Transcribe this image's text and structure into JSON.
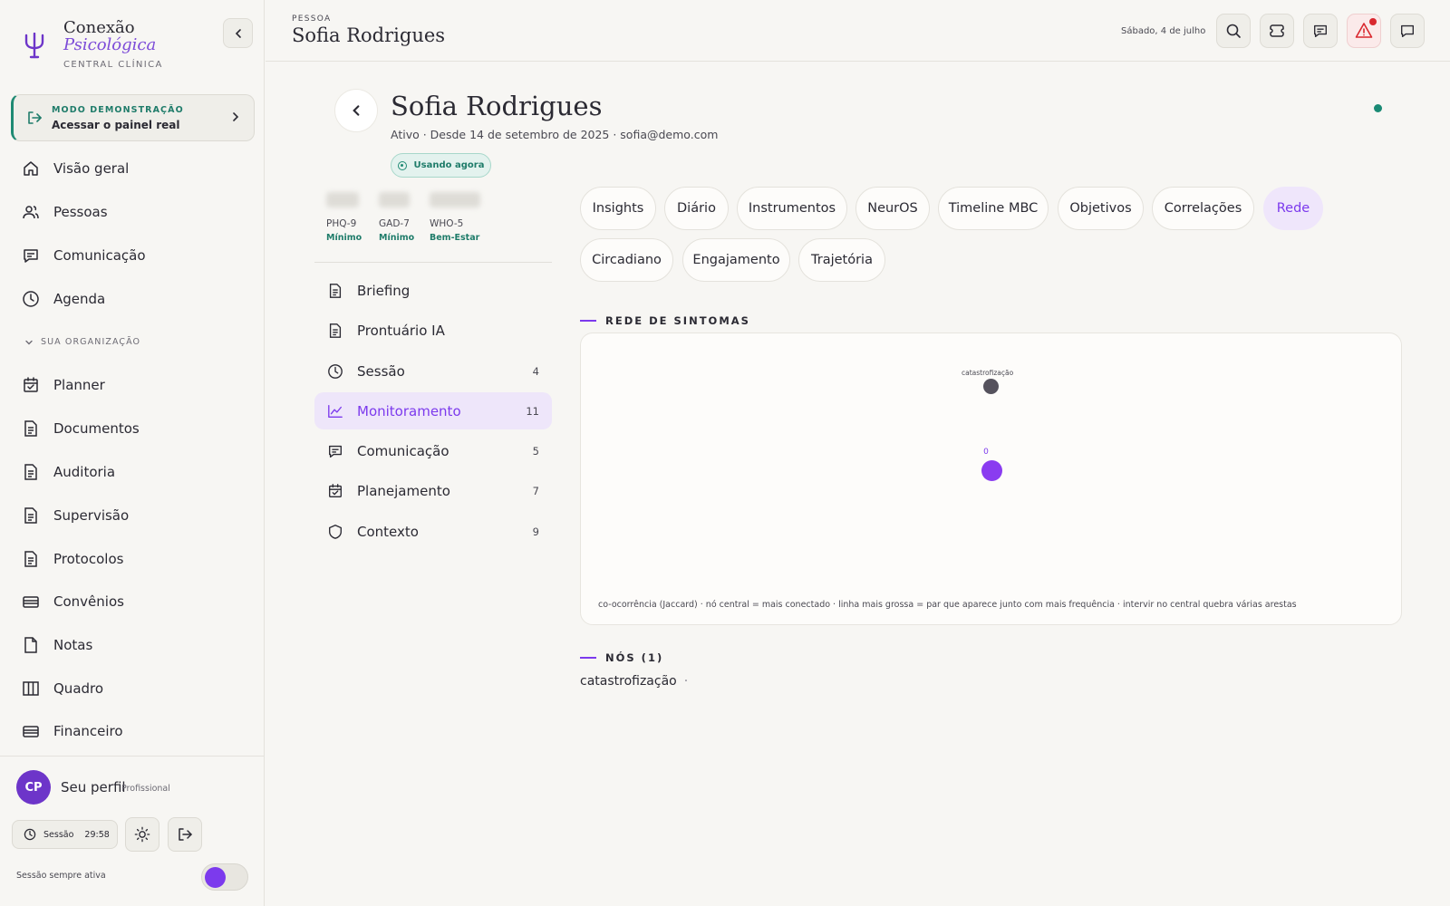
{
  "app": {
    "brand_line1": "Conexão",
    "brand_line2": "Psicológica",
    "brand_line3": "CENTRAL CLÍNICA"
  },
  "demo": {
    "tag": "MODO DEMONSTRAÇÃO",
    "text": "Acessar o painel real"
  },
  "sidebar": {
    "main_items": [
      {
        "label": "Visão geral",
        "icon": "home-icon"
      },
      {
        "label": "Pessoas",
        "icon": "users-icon"
      },
      {
        "label": "Comunicação",
        "icon": "message-icon"
      },
      {
        "label": "Agenda",
        "icon": "clock-icon"
      }
    ],
    "org_label": "SUA ORGANIZAÇÃO",
    "org_items": [
      {
        "label": "Planner",
        "icon": "calendar-check-icon"
      },
      {
        "label": "Documentos",
        "icon": "document-icon"
      },
      {
        "label": "Auditoria",
        "icon": "document-icon"
      },
      {
        "label": "Supervisão",
        "icon": "document-icon"
      },
      {
        "label": "Protocolos",
        "icon": "document-icon"
      },
      {
        "label": "Convênios",
        "icon": "card-icon"
      },
      {
        "label": "Notas",
        "icon": "file-icon"
      },
      {
        "label": "Quadro",
        "icon": "columns-icon"
      },
      {
        "label": "Financeiro",
        "icon": "card-icon"
      }
    ],
    "profile": {
      "initials": "CP",
      "name": "Seu perfil",
      "role": "Profissional"
    },
    "session": {
      "label": "Sessão",
      "time": "29:58"
    },
    "always_active_label": "Sessão sempre ativa"
  },
  "topbar": {
    "kicker": "PESSOA",
    "title": "Sofia Rodrigues",
    "date": "Sábado, 4 de julho"
  },
  "person": {
    "name": "Sofia Rodrigues",
    "meta": "Ativo · Desde 14 de setembro de 2025 · sofia@demo.com",
    "badge": "Usando agora"
  },
  "scores": [
    {
      "label": "PHQ-9",
      "severity": "Mínimo"
    },
    {
      "label": "GAD-7",
      "severity": "Mínimo"
    },
    {
      "label": "WHO-5",
      "severity": "Bem-Estar"
    }
  ],
  "menu": [
    {
      "label": "Briefing",
      "count": "",
      "icon": "document-icon"
    },
    {
      "label": "Prontuário IA",
      "count": "",
      "icon": "document-icon"
    },
    {
      "label": "Sessão",
      "count": "4",
      "icon": "clock-icon"
    },
    {
      "label": "Monitoramento",
      "count": "11",
      "icon": "chart-line-icon",
      "active": true
    },
    {
      "label": "Comunicação",
      "count": "5",
      "icon": "message-icon"
    },
    {
      "label": "Planejamento",
      "count": "7",
      "icon": "calendar-check-icon"
    },
    {
      "label": "Contexto",
      "count": "9",
      "icon": "shield-icon"
    }
  ],
  "tabs": [
    {
      "label": "Insights"
    },
    {
      "label": "Diário"
    },
    {
      "label": "Instrumentos"
    },
    {
      "label": "NeurOS"
    },
    {
      "label": "Timeline MBC"
    },
    {
      "label": "Objetivos"
    },
    {
      "label": "Correlações"
    },
    {
      "label": "Rede",
      "active": true
    },
    {
      "label": "Circadiano"
    },
    {
      "label": "Engajamento"
    },
    {
      "label": "Trajetória"
    }
  ],
  "network": {
    "title": "REDE DE SINTOMAS",
    "nodes": [
      {
        "label": "catastrofização"
      },
      {
        "label": "0"
      }
    ],
    "caption": "co-ocorrência (Jaccard) · nó central = mais conectado · linha mais grossa = par que aparece junto com mais frequência · intervir no central quebra várias arestas"
  },
  "nodes_section": {
    "title": "NÓS (1)",
    "items": [
      "catastrofização"
    ],
    "separator": "·"
  },
  "colors": {
    "accent": "#7c3aed",
    "teal": "#1f8a73",
    "alert": "#d9272e"
  }
}
